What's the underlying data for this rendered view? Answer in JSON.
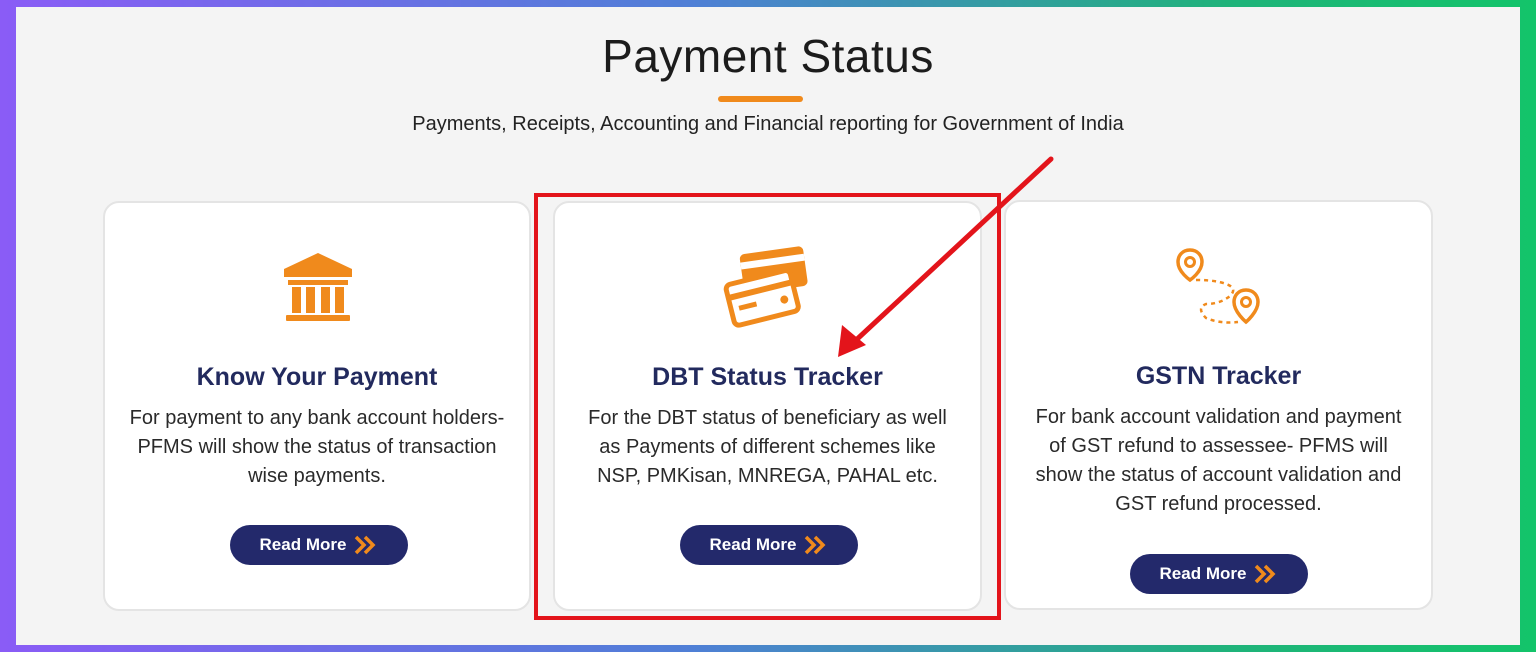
{
  "header": {
    "title": "Payment Status",
    "subtitle": "Payments, Receipts, Accounting and Financial reporting for Government of India"
  },
  "cards": [
    {
      "icon": "bank-icon",
      "title": "Know Your Payment",
      "description": "For payment to any bank account holders- PFMS will show the status of transaction wise payments.",
      "button_label": "Read More"
    },
    {
      "icon": "credit-cards-icon",
      "title": "DBT Status Tracker",
      "description": "For the DBT status of beneficiary as well as Payments of different schemes like NSP, PMKisan, MNREGA, PAHAL etc.",
      "button_label": "Read More"
    },
    {
      "icon": "route-pins-icon",
      "title": "GSTN Tracker",
      "description": "For bank account validation and payment of GST refund to assessee- PFMS will show the status of account validation and GST refund processed.",
      "button_label": "Read More"
    }
  ],
  "colors": {
    "accent": "#f08a1c",
    "button": "#23296b",
    "title": "#222a5e",
    "highlight": "#e3141b"
  }
}
